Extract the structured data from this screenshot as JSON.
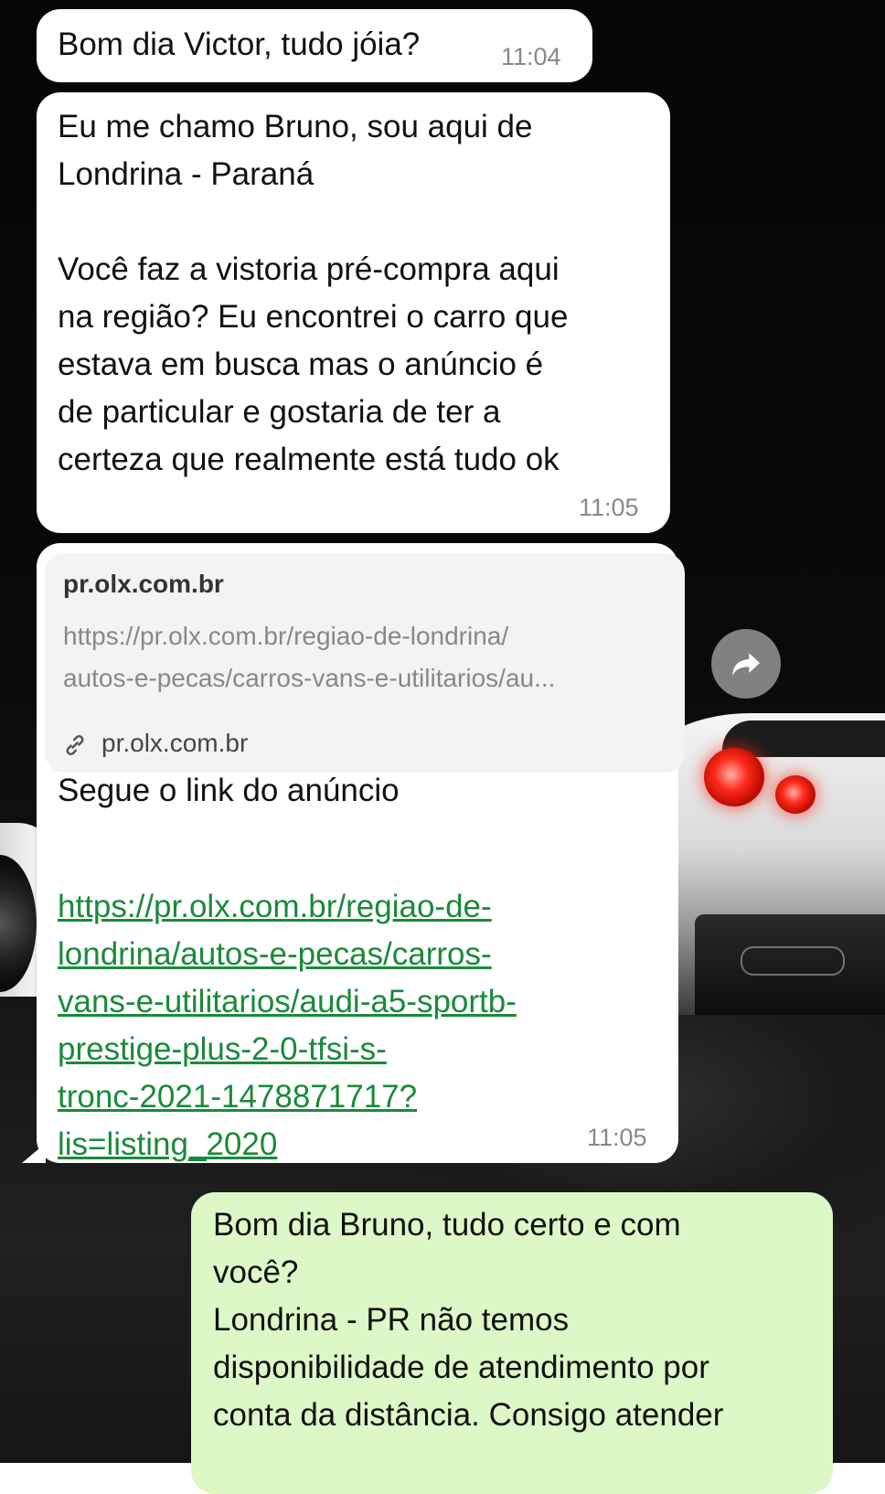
{
  "messages": [
    {
      "direction": "in",
      "text": "Bom dia Victor, tudo jóia?",
      "time": "11:04"
    },
    {
      "direction": "in",
      "text": "Eu me chamo Bruno, sou aqui de\nLondrina - Paraná\n\nVocê faz a vistoria pré-compra aqui\nna região? Eu encontrei o carro que\nestava em busca mas o anúncio é\nde particular e gostaria de ter a\ncerteza que realmente está tudo ok",
      "time": "11:05"
    },
    {
      "direction": "in",
      "preview": {
        "title": "pr.olx.com.br",
        "url": "https://pr.olx.com.br/regiao-de-londrina/\nautos-e-pecas/carros-vans-e-utilitarios/au...",
        "domain": "pr.olx.com.br"
      },
      "text": "Segue o link do anúncio",
      "link": "https://pr.olx.com.br/regiao-de-\nlondrina/autos-e-pecas/carros-\nvans-e-utilitarios/audi-a5-sportb-\nprestige-plus-2-0-tfsi-s-\ntronc-2021-1478871717?\nlis=listing_2020",
      "time": "11:05"
    },
    {
      "direction": "out",
      "text": "Bom dia Bruno, tudo certo e com\nvocê?\nLondrina - PR não temos\ndisponibilidade de atendimento por\nconta da distância. Consigo atender"
    }
  ],
  "icons": {
    "share": "share-forward-icon",
    "link": "link-chain-icon"
  },
  "colors": {
    "incoming": "#ffffff",
    "outgoing": "#dcf8c6",
    "link": "#1a8a3a",
    "time": "#888888"
  }
}
